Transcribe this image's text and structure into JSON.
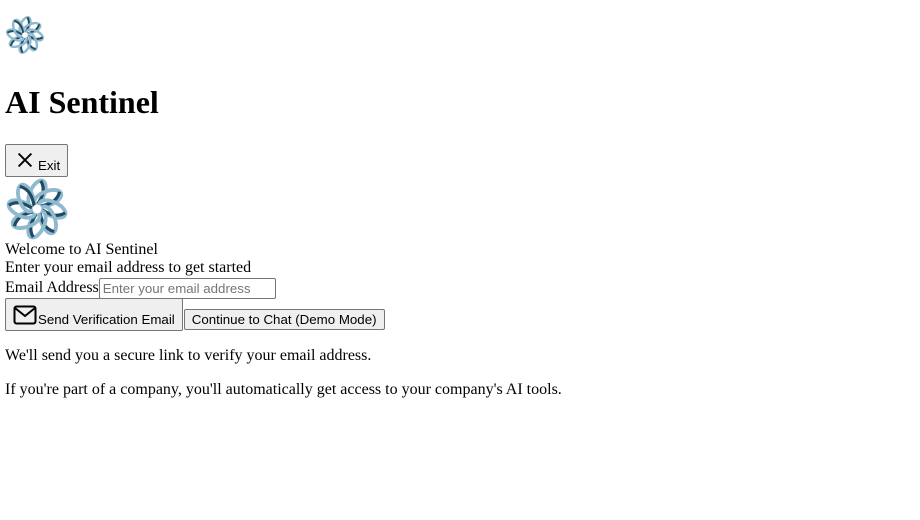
{
  "app": {
    "title": "AI Sentinel",
    "logo_icon": "flower-logo-icon"
  },
  "header": {
    "exit_label": "Exit",
    "exit_icon": "close-icon"
  },
  "login": {
    "welcome": "Welcome to AI Sentinel",
    "subtitle": "Enter your email address to get started",
    "email_label": "Email Address",
    "email_value": "",
    "email_placeholder": "Enter your email address",
    "send_label": "Send Verification Email",
    "send_icon": "envelope-icon",
    "demo_label": "Continue to Chat (Demo Mode)",
    "note_1": "We'll send you a secure link to verify your email address.",
    "note_2": "If you're part of a company, you'll automatically get access to your company's AI tools."
  },
  "colors": {
    "logo_dark": "#1f4a60",
    "logo_light": "#8fb9cf"
  }
}
